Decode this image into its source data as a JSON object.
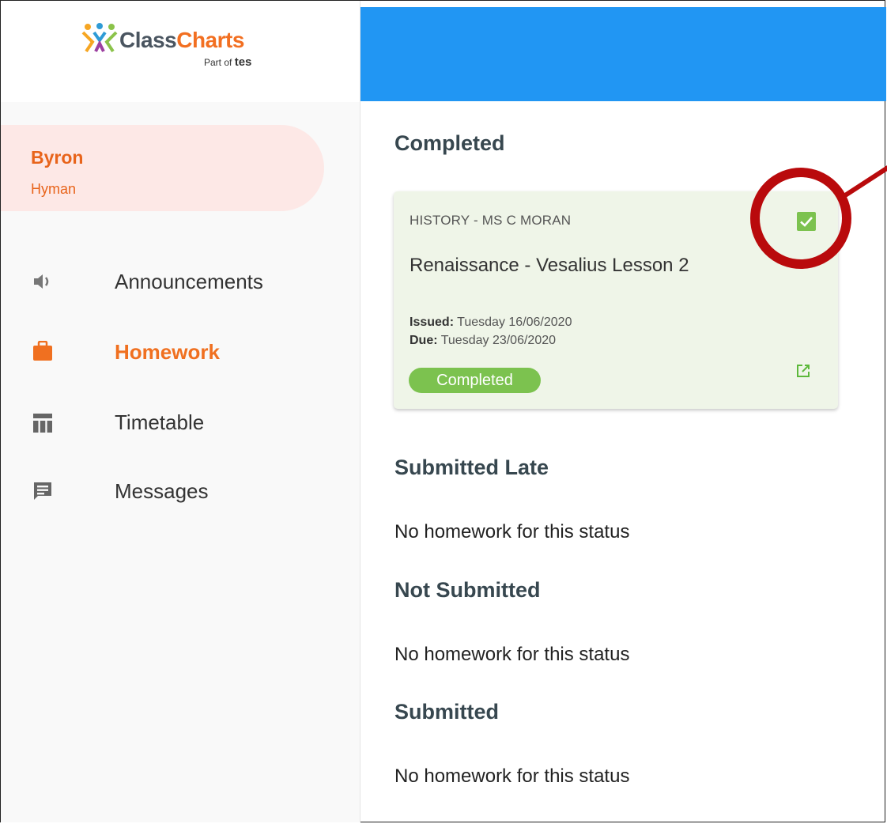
{
  "brand": {
    "name_part1": "Class",
    "name_part2": "Charts",
    "sub_prefix": "Part of",
    "sub_brand": "tes"
  },
  "user": {
    "first_name": "Byron",
    "last_name": "Hyman"
  },
  "nav": {
    "items": [
      {
        "label": "Announcements",
        "icon": "speaker-icon",
        "active": false
      },
      {
        "label": "Homework",
        "icon": "briefcase-icon",
        "active": true
      },
      {
        "label": "Timetable",
        "icon": "table-icon",
        "active": false
      },
      {
        "label": "Messages",
        "icon": "message-icon",
        "active": false
      }
    ]
  },
  "sections": {
    "completed": {
      "title": "Completed",
      "card": {
        "subject": "HISTORY - MS C MORAN",
        "title": "Renaissance - Vesalius Lesson 2",
        "issued_label": "Issued:",
        "issued_value": "Tuesday 16/06/2020",
        "due_label": "Due:",
        "due_value": "Tuesday 23/06/2020",
        "status_badge": "Completed",
        "checked": true
      }
    },
    "submitted_late": {
      "title": "Submitted Late",
      "empty": "No homework for this status"
    },
    "not_submitted": {
      "title": "Not Submitted",
      "empty": "No homework for this status"
    },
    "submitted": {
      "title": "Submitted",
      "empty": "No homework for this status"
    }
  },
  "colors": {
    "topbar": "#2196f3",
    "accent": "#f07020",
    "completed_green": "#7cc24f",
    "card_bg": "#eff5e8",
    "annotation_red": "#b90a0c",
    "user_pill": "#fde8e6"
  }
}
